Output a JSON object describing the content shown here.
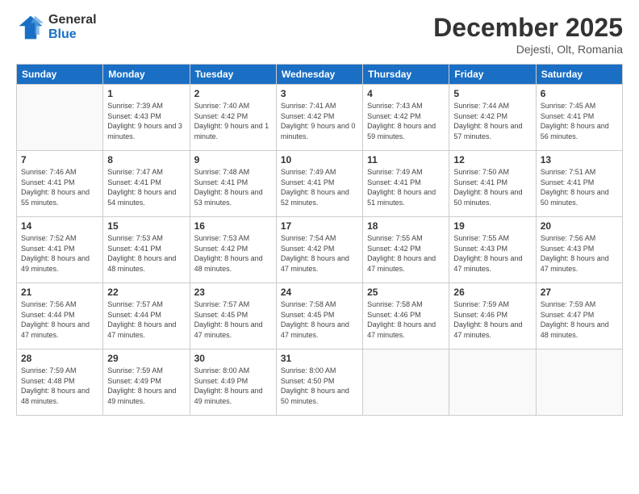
{
  "header": {
    "logo_line1": "General",
    "logo_line2": "Blue",
    "month": "December 2025",
    "location": "Dejesti, Olt, Romania"
  },
  "days_of_week": [
    "Sunday",
    "Monday",
    "Tuesday",
    "Wednesday",
    "Thursday",
    "Friday",
    "Saturday"
  ],
  "weeks": [
    [
      {
        "day": "",
        "sunrise": "",
        "sunset": "",
        "daylight": ""
      },
      {
        "day": "1",
        "sunrise": "Sunrise: 7:39 AM",
        "sunset": "Sunset: 4:43 PM",
        "daylight": "Daylight: 9 hours and 3 minutes."
      },
      {
        "day": "2",
        "sunrise": "Sunrise: 7:40 AM",
        "sunset": "Sunset: 4:42 PM",
        "daylight": "Daylight: 9 hours and 1 minute."
      },
      {
        "day": "3",
        "sunrise": "Sunrise: 7:41 AM",
        "sunset": "Sunset: 4:42 PM",
        "daylight": "Daylight: 9 hours and 0 minutes."
      },
      {
        "day": "4",
        "sunrise": "Sunrise: 7:43 AM",
        "sunset": "Sunset: 4:42 PM",
        "daylight": "Daylight: 8 hours and 59 minutes."
      },
      {
        "day": "5",
        "sunrise": "Sunrise: 7:44 AM",
        "sunset": "Sunset: 4:42 PM",
        "daylight": "Daylight: 8 hours and 57 minutes."
      },
      {
        "day": "6",
        "sunrise": "Sunrise: 7:45 AM",
        "sunset": "Sunset: 4:41 PM",
        "daylight": "Daylight: 8 hours and 56 minutes."
      }
    ],
    [
      {
        "day": "7",
        "sunrise": "Sunrise: 7:46 AM",
        "sunset": "Sunset: 4:41 PM",
        "daylight": "Daylight: 8 hours and 55 minutes."
      },
      {
        "day": "8",
        "sunrise": "Sunrise: 7:47 AM",
        "sunset": "Sunset: 4:41 PM",
        "daylight": "Daylight: 8 hours and 54 minutes."
      },
      {
        "day": "9",
        "sunrise": "Sunrise: 7:48 AM",
        "sunset": "Sunset: 4:41 PM",
        "daylight": "Daylight: 8 hours and 53 minutes."
      },
      {
        "day": "10",
        "sunrise": "Sunrise: 7:49 AM",
        "sunset": "Sunset: 4:41 PM",
        "daylight": "Daylight: 8 hours and 52 minutes."
      },
      {
        "day": "11",
        "sunrise": "Sunrise: 7:49 AM",
        "sunset": "Sunset: 4:41 PM",
        "daylight": "Daylight: 8 hours and 51 minutes."
      },
      {
        "day": "12",
        "sunrise": "Sunrise: 7:50 AM",
        "sunset": "Sunset: 4:41 PM",
        "daylight": "Daylight: 8 hours and 50 minutes."
      },
      {
        "day": "13",
        "sunrise": "Sunrise: 7:51 AM",
        "sunset": "Sunset: 4:41 PM",
        "daylight": "Daylight: 8 hours and 50 minutes."
      }
    ],
    [
      {
        "day": "14",
        "sunrise": "Sunrise: 7:52 AM",
        "sunset": "Sunset: 4:41 PM",
        "daylight": "Daylight: 8 hours and 49 minutes."
      },
      {
        "day": "15",
        "sunrise": "Sunrise: 7:53 AM",
        "sunset": "Sunset: 4:41 PM",
        "daylight": "Daylight: 8 hours and 48 minutes."
      },
      {
        "day": "16",
        "sunrise": "Sunrise: 7:53 AM",
        "sunset": "Sunset: 4:42 PM",
        "daylight": "Daylight: 8 hours and 48 minutes."
      },
      {
        "day": "17",
        "sunrise": "Sunrise: 7:54 AM",
        "sunset": "Sunset: 4:42 PM",
        "daylight": "Daylight: 8 hours and 47 minutes."
      },
      {
        "day": "18",
        "sunrise": "Sunrise: 7:55 AM",
        "sunset": "Sunset: 4:42 PM",
        "daylight": "Daylight: 8 hours and 47 minutes."
      },
      {
        "day": "19",
        "sunrise": "Sunrise: 7:55 AM",
        "sunset": "Sunset: 4:43 PM",
        "daylight": "Daylight: 8 hours and 47 minutes."
      },
      {
        "day": "20",
        "sunrise": "Sunrise: 7:56 AM",
        "sunset": "Sunset: 4:43 PM",
        "daylight": "Daylight: 8 hours and 47 minutes."
      }
    ],
    [
      {
        "day": "21",
        "sunrise": "Sunrise: 7:56 AM",
        "sunset": "Sunset: 4:44 PM",
        "daylight": "Daylight: 8 hours and 47 minutes."
      },
      {
        "day": "22",
        "sunrise": "Sunrise: 7:57 AM",
        "sunset": "Sunset: 4:44 PM",
        "daylight": "Daylight: 8 hours and 47 minutes."
      },
      {
        "day": "23",
        "sunrise": "Sunrise: 7:57 AM",
        "sunset": "Sunset: 4:45 PM",
        "daylight": "Daylight: 8 hours and 47 minutes."
      },
      {
        "day": "24",
        "sunrise": "Sunrise: 7:58 AM",
        "sunset": "Sunset: 4:45 PM",
        "daylight": "Daylight: 8 hours and 47 minutes."
      },
      {
        "day": "25",
        "sunrise": "Sunrise: 7:58 AM",
        "sunset": "Sunset: 4:46 PM",
        "daylight": "Daylight: 8 hours and 47 minutes."
      },
      {
        "day": "26",
        "sunrise": "Sunrise: 7:59 AM",
        "sunset": "Sunset: 4:46 PM",
        "daylight": "Daylight: 8 hours and 47 minutes."
      },
      {
        "day": "27",
        "sunrise": "Sunrise: 7:59 AM",
        "sunset": "Sunset: 4:47 PM",
        "daylight": "Daylight: 8 hours and 48 minutes."
      }
    ],
    [
      {
        "day": "28",
        "sunrise": "Sunrise: 7:59 AM",
        "sunset": "Sunset: 4:48 PM",
        "daylight": "Daylight: 8 hours and 48 minutes."
      },
      {
        "day": "29",
        "sunrise": "Sunrise: 7:59 AM",
        "sunset": "Sunset: 4:49 PM",
        "daylight": "Daylight: 8 hours and 49 minutes."
      },
      {
        "day": "30",
        "sunrise": "Sunrise: 8:00 AM",
        "sunset": "Sunset: 4:49 PM",
        "daylight": "Daylight: 8 hours and 49 minutes."
      },
      {
        "day": "31",
        "sunrise": "Sunrise: 8:00 AM",
        "sunset": "Sunset: 4:50 PM",
        "daylight": "Daylight: 8 hours and 50 minutes."
      },
      {
        "day": "",
        "sunrise": "",
        "sunset": "",
        "daylight": ""
      },
      {
        "day": "",
        "sunrise": "",
        "sunset": "",
        "daylight": ""
      },
      {
        "day": "",
        "sunrise": "",
        "sunset": "",
        "daylight": ""
      }
    ]
  ]
}
